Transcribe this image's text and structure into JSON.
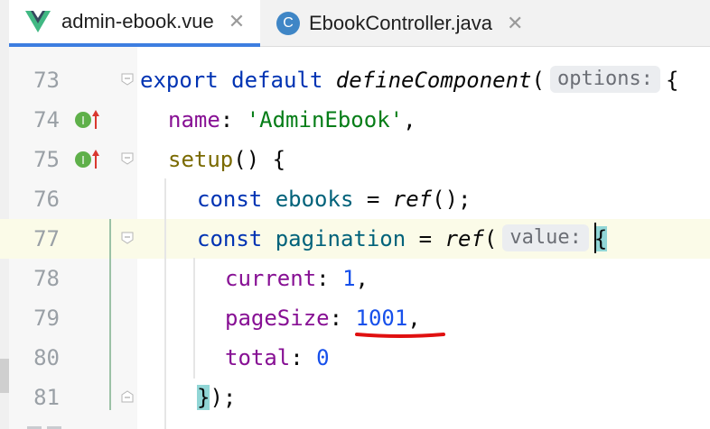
{
  "tabs": [
    {
      "label": "admin-ebook.vue",
      "icon": "vue-logo-icon",
      "active": true
    },
    {
      "label": "EbookController.java",
      "icon": "class-c-icon",
      "active": false
    }
  ],
  "close_glyph": "✕",
  "hints": {
    "options": "options:",
    "value": "value:"
  },
  "lines": [
    {
      "num": "73",
      "tokens": [
        "export",
        " ",
        "default",
        " ",
        "defineComponent",
        "(",
        "{"
      ]
    },
    {
      "num": "74",
      "tokens": [
        "name",
        ": ",
        "'AdminEbook'",
        ","
      ]
    },
    {
      "num": "75",
      "tokens": [
        "setup",
        "() {"
      ]
    },
    {
      "num": "76",
      "tokens": [
        "const",
        " ",
        "ebooks",
        " = ",
        "ref",
        "();"
      ]
    },
    {
      "num": "77",
      "tokens": [
        "const",
        " ",
        "pagination",
        " = ",
        "ref",
        "(",
        "{"
      ]
    },
    {
      "num": "78",
      "tokens": [
        "current",
        ": ",
        "1",
        ","
      ]
    },
    {
      "num": "79",
      "tokens": [
        "pageSize",
        ": ",
        "1001",
        ","
      ]
    },
    {
      "num": "80",
      "tokens": [
        "total",
        ": ",
        "0"
      ]
    },
    {
      "num": "81",
      "tokens": [
        "}",
        ");"
      ]
    }
  ],
  "colors": {
    "keyword": "#0033b3",
    "property": "#871094",
    "string": "#067d17",
    "number": "#1750eb",
    "variable": "#00627a",
    "underline": "#e01010",
    "tab_accent": "#3d7ee0"
  }
}
